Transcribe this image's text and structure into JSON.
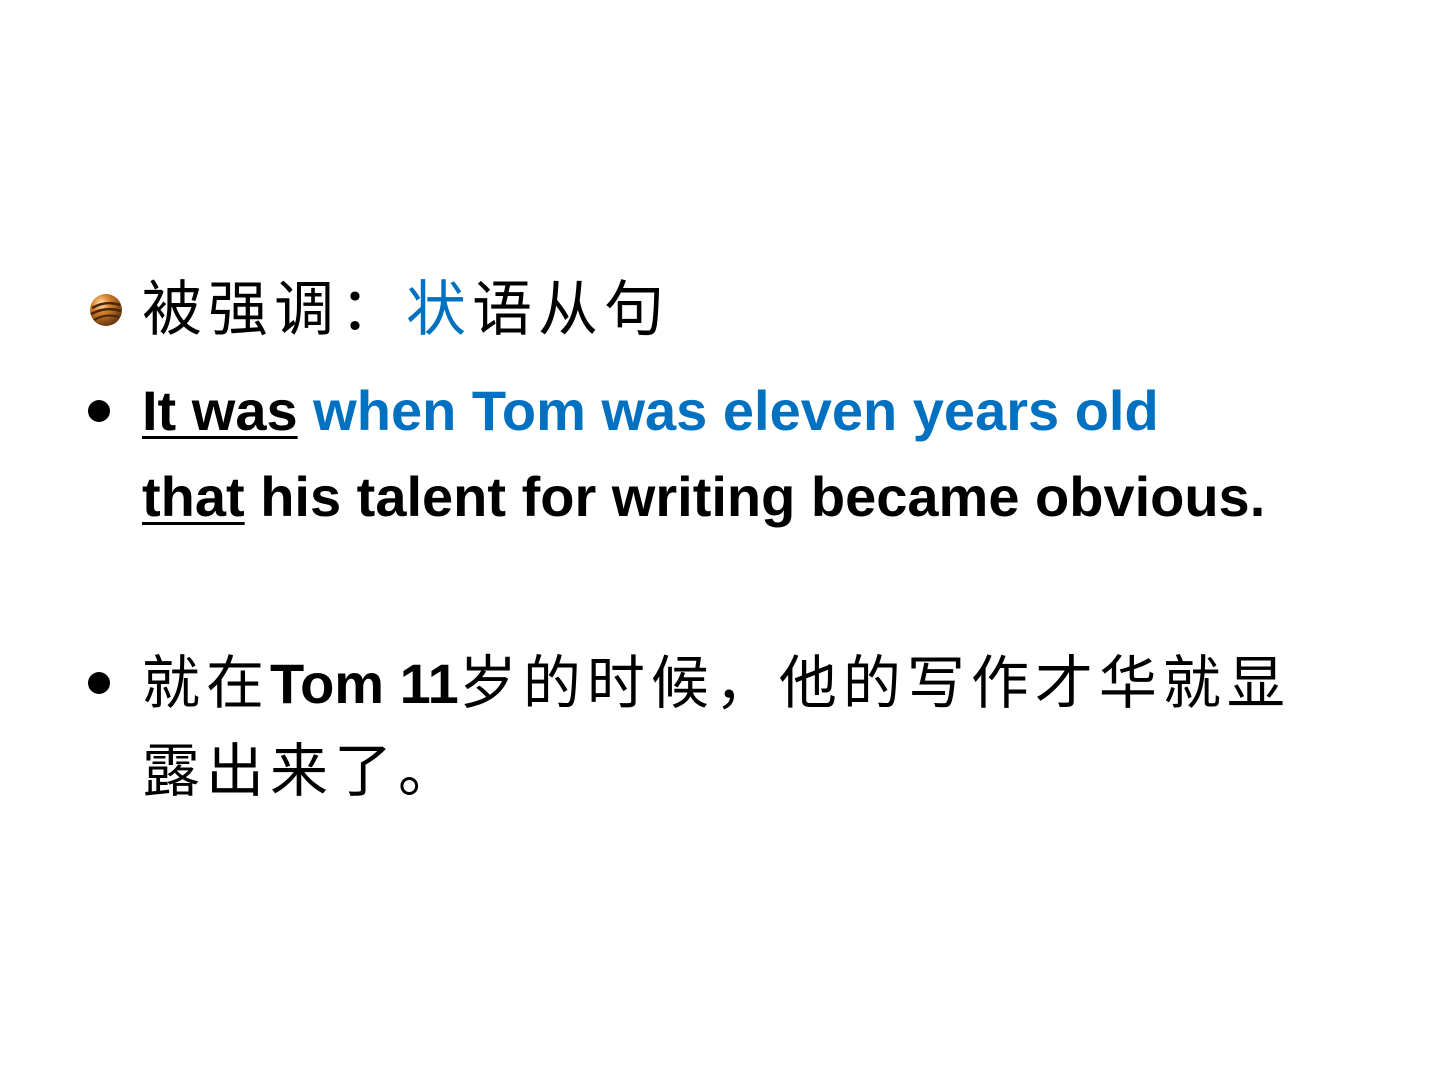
{
  "colors": {
    "text": "#000000",
    "accent_blue": "#0070C0",
    "background": "#FFFFFF"
  },
  "slide": {
    "item1": {
      "bullet_icon": "orb-icon",
      "label": "被强调：",
      "highlight": "状",
      "rest": "语从句"
    },
    "item2": {
      "part1": "It was",
      "part2": " when Tom was eleven years old",
      "part3": "that",
      "part4": " his talent for writing became obvious."
    },
    "item3": {
      "part1": "就在",
      "part2": "Tom 11",
      "part3": "岁的时候，他的写作才华就显露出来了。"
    }
  }
}
